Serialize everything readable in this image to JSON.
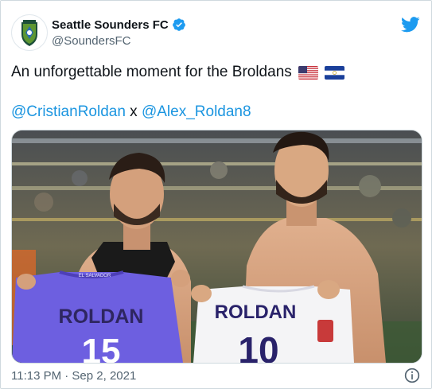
{
  "account": {
    "display_name": "Seattle Sounders FC",
    "handle": "@SoundersFC"
  },
  "icons": {
    "verified": "verified-badge-icon",
    "brand": "twitter-bird-icon",
    "info": "info-icon",
    "flag_1": "us-flag-icon",
    "flag_2": "el-salvador-flag-icon"
  },
  "tweet": {
    "text": "An unforgettable moment for the Broldans",
    "mention_1": "@CristianRoldan",
    "connector": " x ",
    "mention_2": "@Alex_Roldan8",
    "timestamp": "11:13 PM · Sep 2, 2021"
  },
  "photo": {
    "jersey_left_name": "ROLDAN",
    "jersey_left_number": "15",
    "jersey_left_collar": "EL SALVADOR",
    "jersey_right_name": "ROLDAN",
    "jersey_right_number": "10"
  },
  "colors": {
    "accent": "#1b95e0",
    "text": "#0f1419",
    "muted": "#536471",
    "jersey_left": "#6d5fe0",
    "jersey_right": "#f4f4f6"
  }
}
